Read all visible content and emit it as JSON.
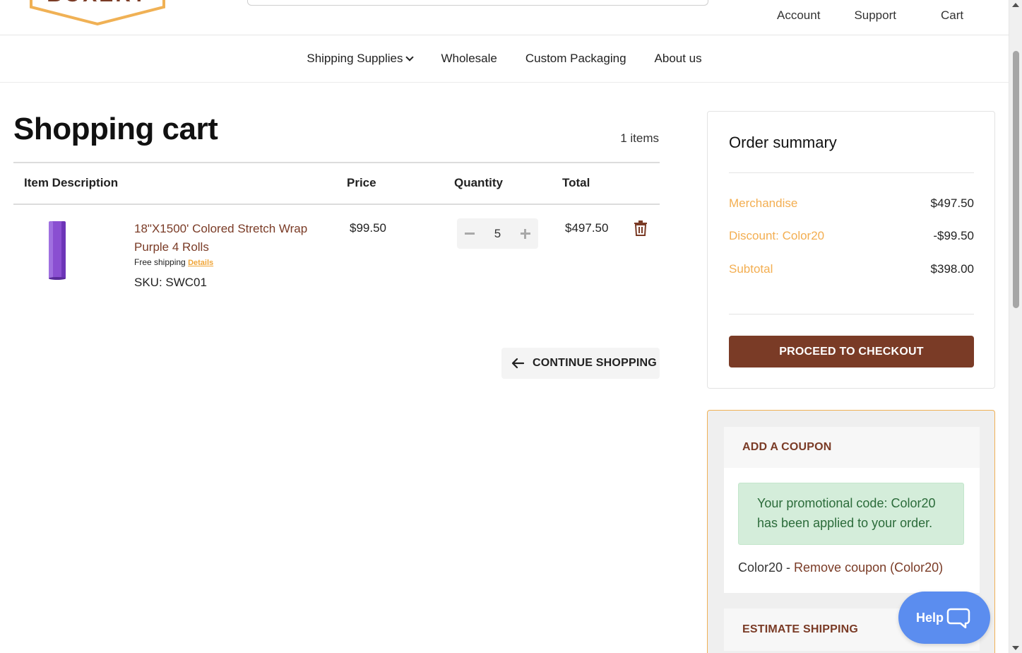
{
  "header": {
    "logo_alt": "BOXERY",
    "links": {
      "account": "Account",
      "support": "Support",
      "cart": "Cart"
    }
  },
  "nav": {
    "items": [
      {
        "label": "Shipping Supplies"
      },
      {
        "label": "Wholesale"
      },
      {
        "label": "Custom Packaging"
      },
      {
        "label": "About us"
      }
    ]
  },
  "cart": {
    "title": "Shopping cart",
    "items_count": "1 items",
    "columns": {
      "description": "Item Description",
      "price": "Price",
      "quantity": "Quantity",
      "total": "Total"
    },
    "line_items": [
      {
        "name": "18\"X1500' Colored Stretch Wrap Purple 4 Rolls",
        "free_shipping": "Free shipping",
        "details_link": "Details",
        "sku": "SKU: SWC01",
        "price": "$99.50",
        "quantity": "5",
        "total": "$497.50",
        "image_color": "#8a4fd1"
      }
    ],
    "continue_label": "CONTINUE SHOPPING"
  },
  "summary": {
    "title": "Order summary",
    "rows": {
      "merchandise": {
        "label": "Merchandise",
        "value": "$497.50"
      },
      "discount": {
        "label": "Discount: Color20",
        "value": "-$99.50"
      },
      "subtotal": {
        "label": "Subtotal",
        "value": "$398.00"
      }
    },
    "checkout_label": "PROCEED TO CHECKOUT"
  },
  "coupon": {
    "header": "ADD A COUPON",
    "message": "Your promotional code: Color20 has been applied to your order.",
    "code": "Color20",
    "separator": " - ",
    "remove_label": "Remove coupon (Color20)"
  },
  "shipping": {
    "header": "ESTIMATE SHIPPING"
  },
  "help": {
    "label": "Help"
  },
  "colors": {
    "brand_brown": "#7a3b26",
    "accent_orange": "#f3ae51",
    "help_blue": "#5b8def",
    "success_bg": "#d4edda"
  }
}
